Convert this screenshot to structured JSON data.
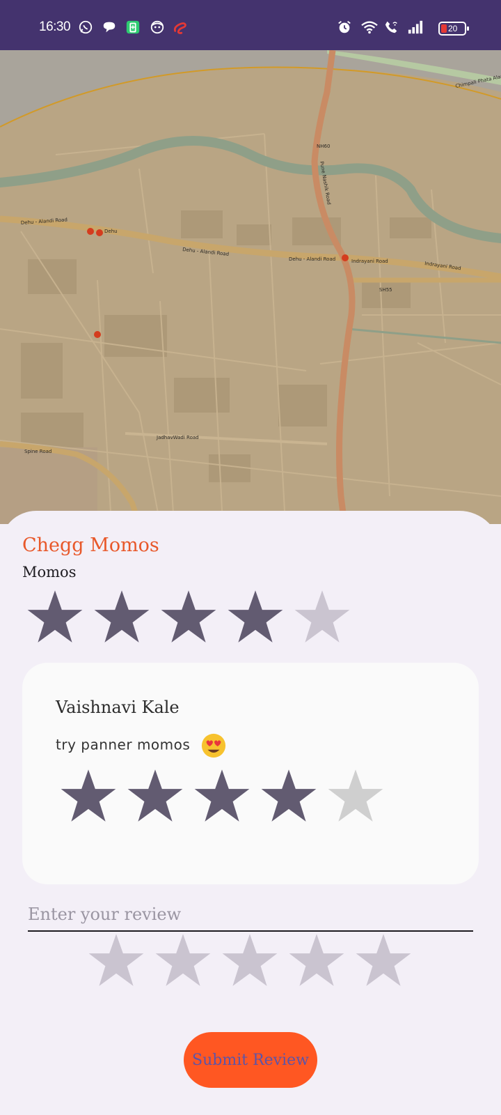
{
  "status_bar": {
    "time": "16:30",
    "battery": "20",
    "background": "#44336e",
    "icons": [
      "whatsapp-icon",
      "chat-bubble-icon",
      "battery-saver-icon",
      "face-icon",
      "airtel-icon",
      "alarm-icon",
      "wifi-icon",
      "wifi-call-icon",
      "signal-icon",
      "battery-icon"
    ]
  },
  "map": {
    "labels": {
      "dehu_alandi_road_1": "Dehu - Alandi Road",
      "dehu_alandi_road_2": "Dehu - Alandi Road",
      "dehu_alandi_road_3": "Dehu - Alandi Road",
      "dehu": "Dehu",
      "indrayani_road": "Indrayani Road",
      "indrayani_road_2": "Indrayani Road",
      "pune_nashik_road": "Pune Nashik Road",
      "nh60": "NH60",
      "sh55": "SH55",
      "jadhavwadi_road": "JadhavWadi Road",
      "spine_road": "Spine Road",
      "chimpali_phata_alandi": "Chimpali Phata Alandi"
    },
    "colors": {
      "land": "#b9a584",
      "river": "#8f9f88",
      "road": "#c8a66b",
      "highway": "#c98b64"
    }
  },
  "place": {
    "name": "Chegg Momos",
    "category": "Momos",
    "rating": 4,
    "max_rating": 5
  },
  "review": {
    "author": "Vaishnavi Kale",
    "text": "try panner momos",
    "rating": 4,
    "max_rating": 5
  },
  "input": {
    "placeholder": "Enter your review",
    "value": "",
    "rating": 0,
    "max_rating": 5
  },
  "submit_label": "Submit Review",
  "colors": {
    "accent": "#ff5722",
    "title": "#e8582a",
    "star_filled": "#625b71",
    "star_empty": "#cac4d0",
    "star_empty_card": "#cfcfcf",
    "sheet": "#f3eff7",
    "card": "#fafafa"
  }
}
